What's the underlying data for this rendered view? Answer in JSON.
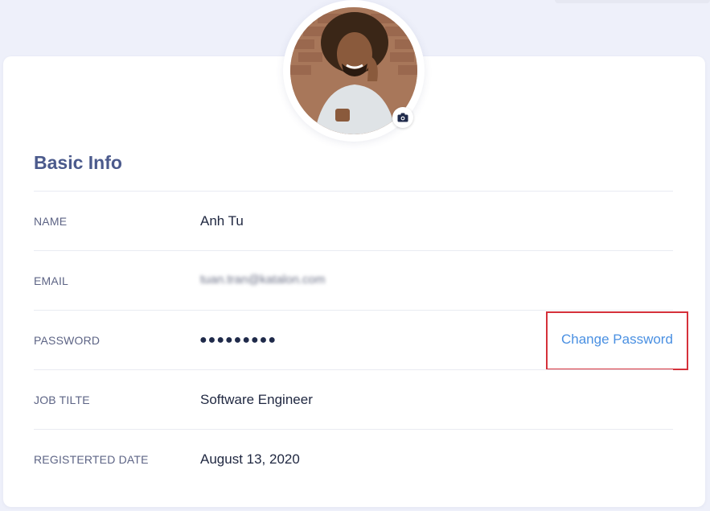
{
  "profile": {
    "avatar_alt": "profile photo",
    "camera_icon": "camera-icon"
  },
  "basic_info": {
    "title": "Basic Info",
    "rows": [
      {
        "label": "NAME",
        "value": "Anh Tu"
      },
      {
        "label": "EMAIL",
        "value": "tuan.tran@katalon.com"
      },
      {
        "label": "PASSWORD",
        "value": "●●●●●●●●●"
      },
      {
        "label": "JOB TILTE",
        "value": "Software Engineer"
      },
      {
        "label": "REGISTERTED DATE",
        "value": "August 13, 2020"
      }
    ],
    "change_password_label": "Change Password"
  },
  "colors": {
    "title": "#4b5a8c",
    "link": "#4a90e2",
    "highlight_box": "#d5313a",
    "background": "#eef0fa"
  }
}
